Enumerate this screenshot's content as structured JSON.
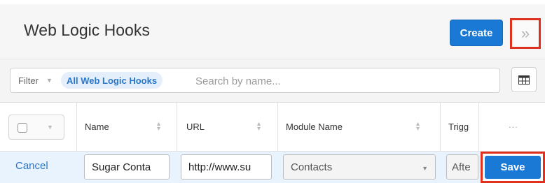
{
  "header": {
    "title": "Web Logic Hooks",
    "create_label": "Create",
    "expand_icon": "double-chevron-right-icon"
  },
  "filter": {
    "label": "Filter",
    "active_filter": "All Web Logic Hooks",
    "search_placeholder": "Search by name..."
  },
  "table": {
    "columns": [
      "Name",
      "URL",
      "Module Name",
      "Trigg"
    ],
    "more_label": "..."
  },
  "edit_row": {
    "cancel_label": "Cancel",
    "name_value": "Sugar Conta",
    "url_value": "http://www.su",
    "module_value": "Contacts",
    "trigger_value": "Afte",
    "save_label": "Save"
  },
  "colors": {
    "accent": "#1b79d6",
    "highlight_border": "#e0301e",
    "edit_row_bg": "#e9f3fd"
  }
}
